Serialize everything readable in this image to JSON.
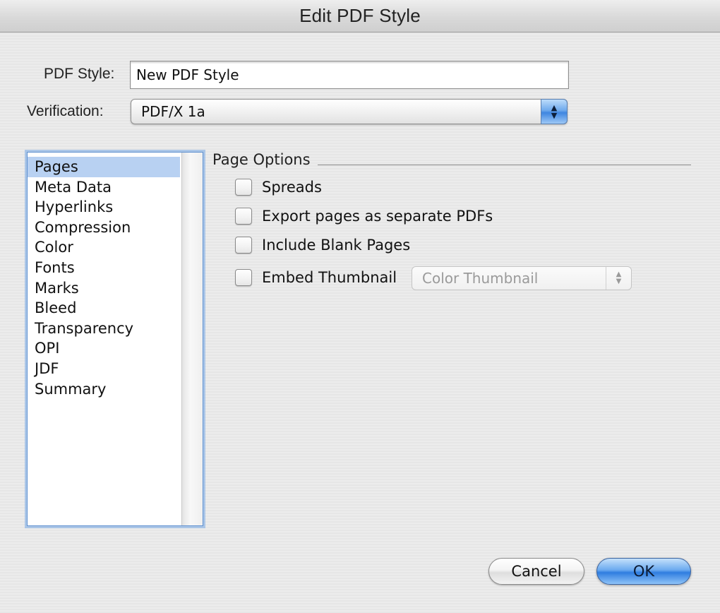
{
  "window": {
    "title": "Edit PDF Style"
  },
  "form": {
    "pdf_style_label": "PDF Style:",
    "pdf_style_value": "New PDF Style",
    "verification_label": "Verification:",
    "verification_value": "PDF/X 1a"
  },
  "sidebar": {
    "items": [
      {
        "label": "Pages",
        "selected": true
      },
      {
        "label": "Meta Data"
      },
      {
        "label": "Hyperlinks"
      },
      {
        "label": "Compression"
      },
      {
        "label": "Color"
      },
      {
        "label": "Fonts"
      },
      {
        "label": "Marks"
      },
      {
        "label": "Bleed"
      },
      {
        "label": "Transparency"
      },
      {
        "label": "OPI"
      },
      {
        "label": "JDF"
      },
      {
        "label": "Summary"
      }
    ]
  },
  "page_options": {
    "title": "Page Options",
    "spreads": {
      "label": "Spreads",
      "checked": false
    },
    "export_separate": {
      "label": "Export pages as separate PDFs",
      "checked": false
    },
    "include_blank": {
      "label": "Include Blank Pages",
      "checked": false
    },
    "embed_thumbnail": {
      "label": "Embed Thumbnail",
      "checked": false
    },
    "thumbnail_type": {
      "value": "Color Thumbnail",
      "enabled": false
    }
  },
  "buttons": {
    "cancel": "Cancel",
    "ok": "OK"
  },
  "icons": {
    "popup_arrows": "up-down-arrows-icon"
  },
  "colors": {
    "selection": "#b8d1f2",
    "accent": "#3f86e0"
  }
}
